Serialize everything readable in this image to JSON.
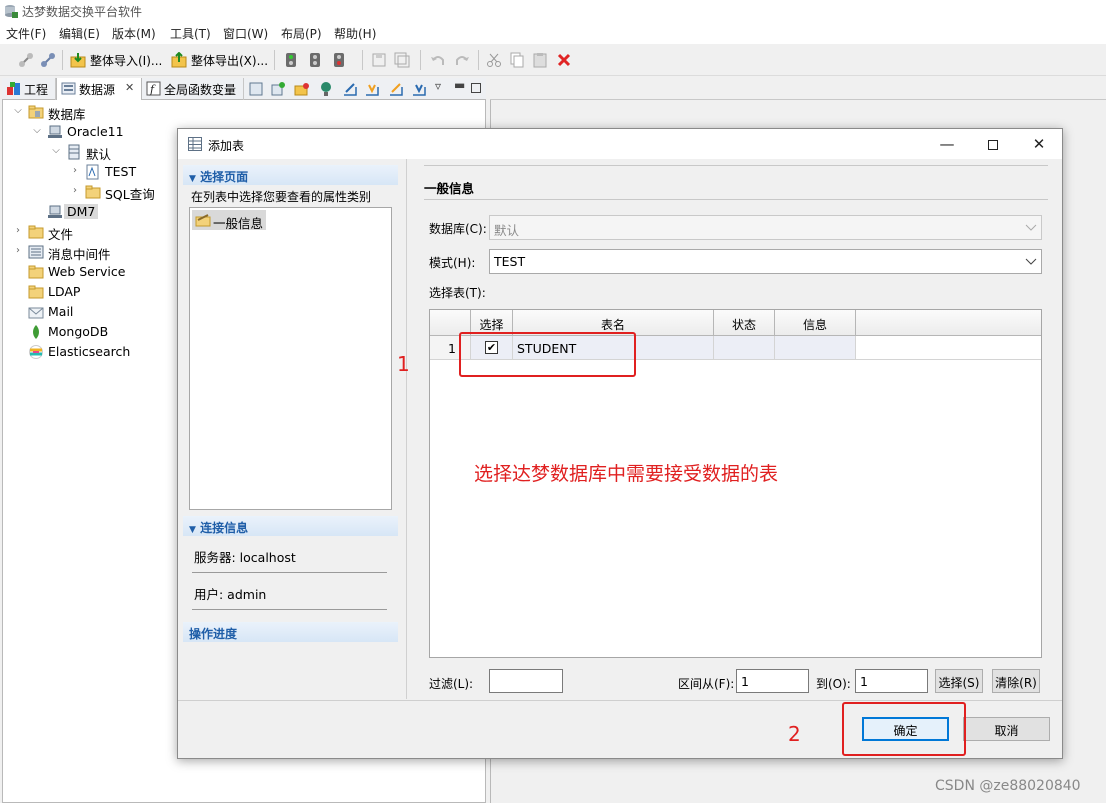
{
  "window": {
    "title": "达梦数据交换平台软件"
  },
  "menu": [
    "文件(F)",
    "编辑(E)",
    "版本(M)",
    "工具(T)",
    "窗口(W)",
    "布局(P)",
    "帮助(H)"
  ],
  "toolbar": {
    "import_label": "整体导入(I)...",
    "export_label": "整体导出(X)..."
  },
  "view_tabs": [
    {
      "label": "工程",
      "icon": "project-icon"
    },
    {
      "label": "数据源",
      "icon": "datasource-icon",
      "closable": true
    },
    {
      "label": "全局函数变量",
      "icon": "function-icon"
    }
  ],
  "tree": {
    "database": "数据库",
    "oracle": "Oracle11",
    "default_schema": "默认",
    "test": "TEST",
    "sql_query": "SQL查询",
    "dm7": "DM7",
    "file": "文件",
    "mq": "消息中间件",
    "web_service": "Web Service",
    "ldap": "LDAP",
    "mail": "Mail",
    "mongodb": "MongoDB",
    "elasticsearch": "Elasticsearch"
  },
  "dialog": {
    "title": "添加表",
    "select_page_header": "选择页面",
    "select_page_hint": "在列表中选择您要查看的属性类别",
    "pages": [
      "一般信息"
    ],
    "connection_header": "连接信息",
    "server": "服务器: localhost",
    "user": "用户: admin",
    "progress_header": "操作进度",
    "section_title": "一般信息",
    "database_label": "数据库(C):",
    "database_value": "默认",
    "schema_label": "模式(H):",
    "schema_value": "TEST",
    "select_table_label": "选择表(T):",
    "table": {
      "columns": [
        "选择",
        "表名",
        "状态",
        "信息"
      ],
      "rows": [
        {
          "index": "1",
          "checked": true,
          "name": "STUDENT",
          "status": "",
          "info": ""
        }
      ]
    },
    "filter_label": "过滤(L):",
    "filter_value": "",
    "range_from_label": "区间从(F):",
    "range_from_value": "1",
    "range_to_label": "到(O):",
    "range_to_value": "1",
    "select_button": "选择(S)",
    "clear_button": "清除(R)",
    "ok_button": "确定",
    "cancel_button": "取消"
  },
  "annotations": {
    "num1": "1",
    "num2": "2",
    "note": "选择达梦数据库中需要接受数据的表"
  },
  "watermark": "CSDN @ze88020840",
  "colors": {
    "annotation": "#e02020",
    "section_header": "#1f5ea8",
    "accent": "#0078d7"
  }
}
